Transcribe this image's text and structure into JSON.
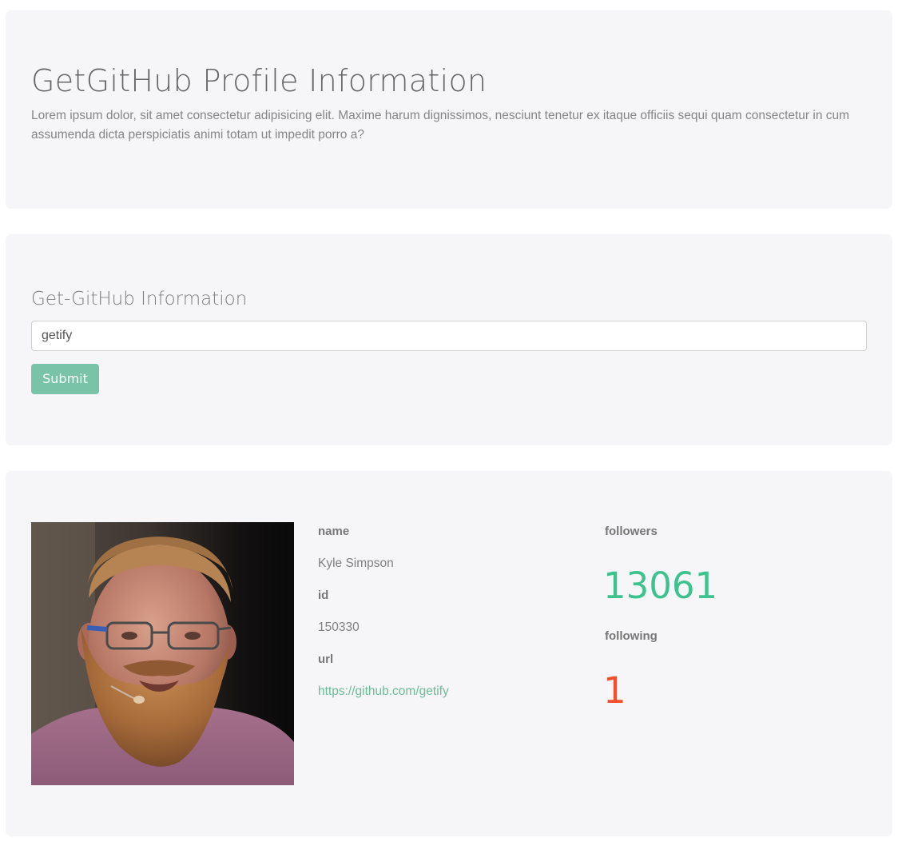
{
  "hero": {
    "title": "GetGitHub Profile Information",
    "text": "Lorem ipsum dolor, sit amet consectetur adipisicing elit. Maxime harum dignissimos, nesciunt tenetur ex itaque officiis sequi quam consectetur in cum assumenda dicta perspiciatis animi totam ut impedit porro a?"
  },
  "form": {
    "title": "Get-GitHub Information",
    "username_value": "getify",
    "submit_label": "Submit"
  },
  "profile": {
    "name_label": "name",
    "name_value": "Kyle Simpson",
    "id_label": "id",
    "id_value": "150330",
    "url_label": "url",
    "url_value": "https://github.com/getify",
    "followers_label": "followers",
    "followers_value": "13061",
    "following_label": "following",
    "following_value": "1"
  },
  "colors": {
    "card_background": "#f6f6f8",
    "accent_green": "#3ec28f",
    "accent_red": "#f0502e",
    "button": "#79c3a9",
    "link": "#6cbc9b"
  },
  "icons": {
    "avatar": "profile-photo"
  }
}
